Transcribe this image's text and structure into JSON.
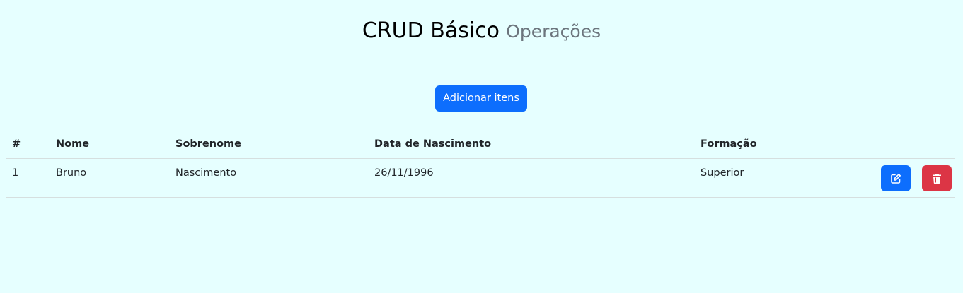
{
  "header": {
    "title": "CRUD Básico",
    "subtitle": "Operações"
  },
  "toolbar": {
    "add_label": "Adicionar itens"
  },
  "table": {
    "columns": [
      "#",
      "Nome",
      "Sobrenome",
      "Data de Nascimento",
      "Formação"
    ],
    "rows": [
      {
        "id": "1",
        "nome": "Bruno",
        "sobrenome": "Nascimento",
        "data_nascimento": "26/11/1996",
        "formacao": "Superior",
        "actions": [
          "edit-icon",
          "trash-icon"
        ]
      }
    ]
  },
  "colors": {
    "background": "#e6ffff",
    "primary": "#0d6efd",
    "danger": "#dc3545",
    "subtitle": "#6c757d"
  }
}
